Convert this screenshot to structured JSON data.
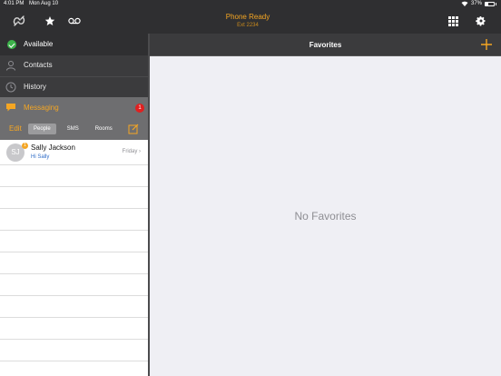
{
  "status_bar": {
    "time": "4:01 PM",
    "date": "Mon Aug 10",
    "wifi_icon": "wifi-icon",
    "battery_text": "37%"
  },
  "top_bar": {
    "title": "Phone Ready",
    "subtitle": "Ext 2234",
    "icons": [
      "logo-icon",
      "star-icon",
      "voicemail-icon",
      "dialpad-icon",
      "gear-icon"
    ],
    "accent_color": "#f5a623"
  },
  "presence": {
    "label": "Available",
    "color": "#3cb34a"
  },
  "nav": {
    "contacts": "Contacts",
    "history": "History",
    "messaging": "Messaging",
    "messaging_badge": "1"
  },
  "messaging_toolbar": {
    "edit": "Edit",
    "segments": [
      {
        "label": "People",
        "active": true
      },
      {
        "label": "SMS",
        "active": false
      },
      {
        "label": "Rooms",
        "active": false
      }
    ]
  },
  "conversations": [
    {
      "initials": "SJ",
      "badge": "1",
      "name": "Sally Jackson",
      "preview": "Hi Sally",
      "date": "Friday"
    }
  ],
  "favorites": {
    "title": "Favorites",
    "empty_text": "No Favorites"
  }
}
